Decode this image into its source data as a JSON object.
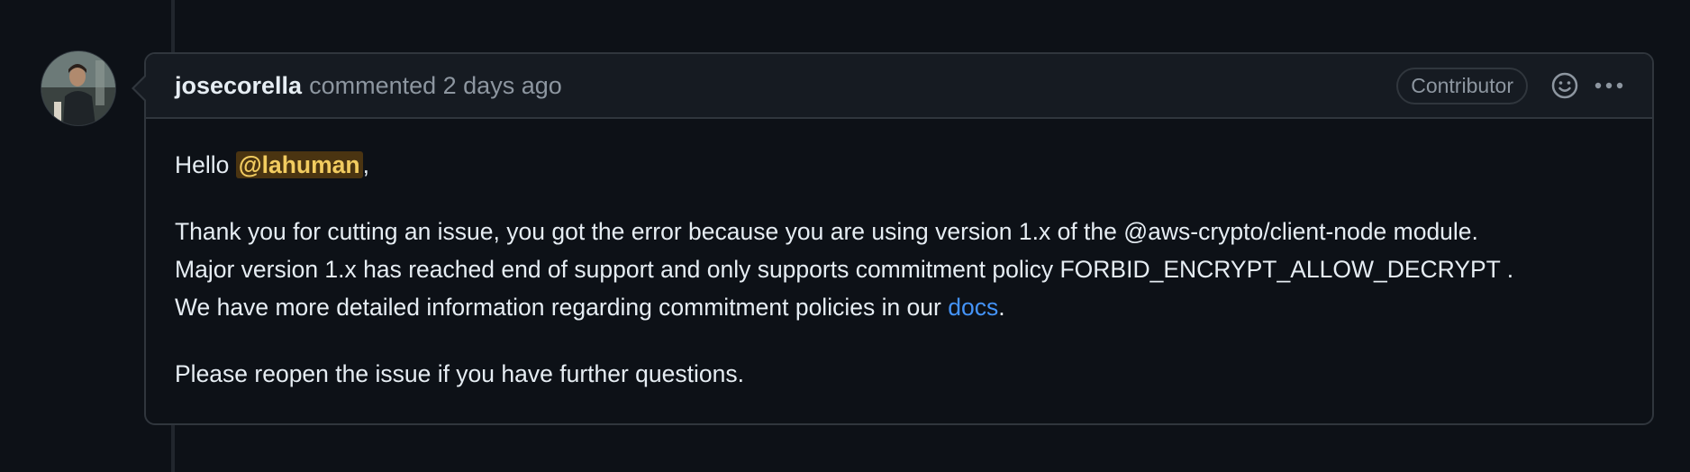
{
  "comment": {
    "author": "josecorella",
    "meta": "commented 2 days ago",
    "role_badge": "Contributor",
    "icons": {
      "reaction": "smiley-icon",
      "menu": "kebab-horizontal-icon"
    },
    "body": {
      "greeting_prefix": "Hello",
      "mention": "@lahuman",
      "greeting_suffix": ",",
      "para2_line1": "Thank you for cutting an issue, you got the error because you are using version 1.x of the @aws-crypto/client-node module.",
      "para2_line2": "Major version 1.x has reached end of support and only supports commitment policy FORBID_ENCRYPT_ALLOW_DECRYPT .",
      "para2_line3_prefix": "We have more detailed information regarding commitment policies in our",
      "link_text": "docs",
      "para2_line3_suffix": ".",
      "para3": "Please reopen the issue if you have further questions."
    }
  },
  "colors": {
    "background": "#0d1117",
    "header_bg": "#161b22",
    "border": "#30363d",
    "muted_text": "#8d96a0",
    "link": "#4493f8",
    "mention_bg": "#4a3411",
    "mention_text": "#f2cc60"
  }
}
